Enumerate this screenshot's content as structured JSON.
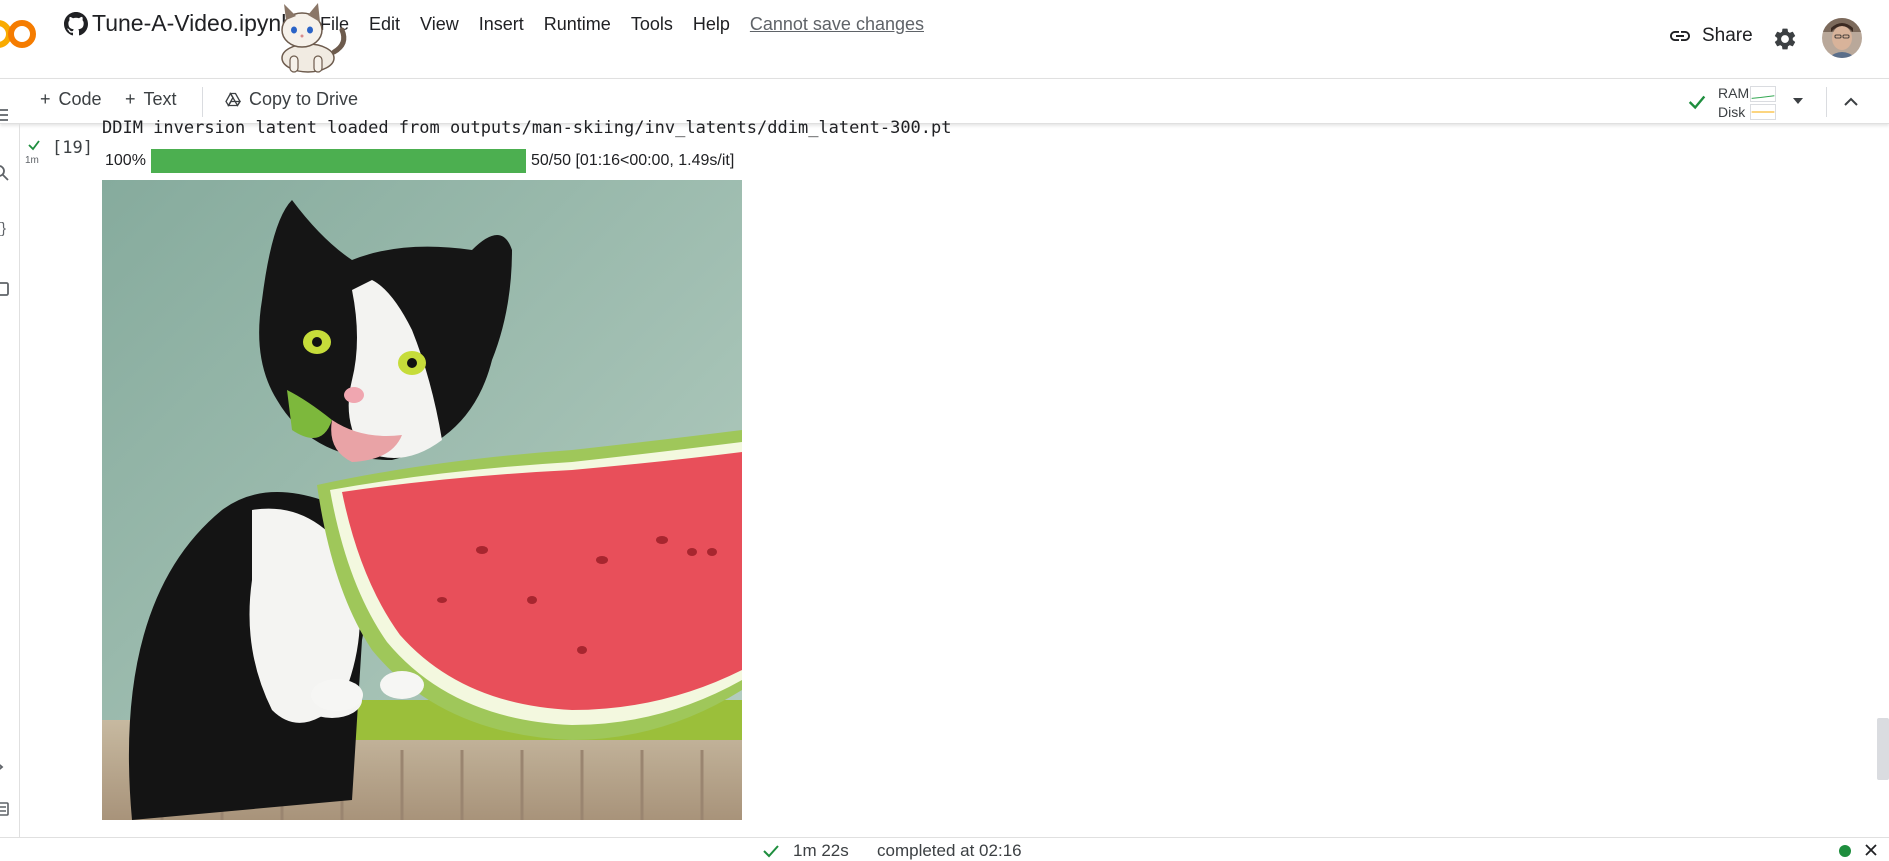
{
  "header": {
    "notebook_title": "Tune-A-Video.ipynb",
    "menu": [
      "File",
      "Edit",
      "View",
      "Insert",
      "Runtime",
      "Tools",
      "Help"
    ],
    "save_status": "Cannot save changes",
    "share_label": "Share",
    "icons": {
      "logo": "colab-logo",
      "repo": "github-icon",
      "share": "link-icon",
      "settings": "gear-icon",
      "account": "avatar"
    }
  },
  "toolbar": {
    "add_code_label": "Code",
    "add_text_label": "Text",
    "copy_drive_label": "Copy to Drive",
    "ram_label": "RAM",
    "disk_label": "Disk",
    "colors": {
      "ram": "#34a853",
      "disk": "#f9ab00",
      "connected": "#1e8e3e"
    }
  },
  "cell": {
    "run_time": "1m",
    "execution_count": "[19]",
    "stdout": "DDIM inversion latent loaded from outputs/man-skiing/inv_latents/ddim_latent-300.pt",
    "progress": {
      "percent_label": "100%",
      "fraction": 1.0,
      "detail": "50/50 [01:16<00:00, 1.49s/it]",
      "bar_color": "#4caf50"
    }
  },
  "statusbar": {
    "duration": "1m 22s",
    "completed": "completed at 02:16"
  }
}
